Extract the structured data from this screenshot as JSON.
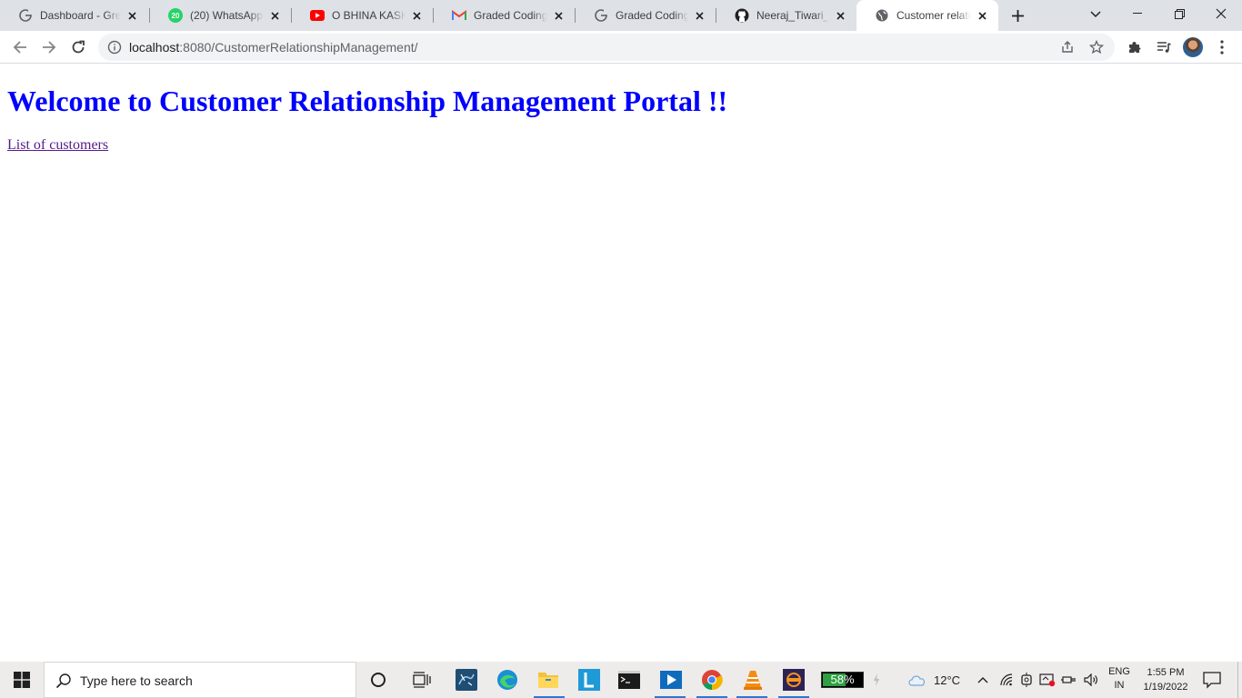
{
  "browser": {
    "tabs": [
      {
        "title": "Dashboard - Great Learning",
        "favicon": "google-icon"
      },
      {
        "title": "(20) WhatsApp",
        "favicon": "whatsapp-icon",
        "badge": "20"
      },
      {
        "title": "O BHINA KASKE",
        "favicon": "youtube-icon"
      },
      {
        "title": "Graded Coding Assignment",
        "favicon": "gmail-icon"
      },
      {
        "title": "Graded Coding Assignment",
        "favicon": "google-icon"
      },
      {
        "title": "Neeraj_Tiwari_OP",
        "favicon": "github-icon"
      },
      {
        "title": "Customer relationship",
        "favicon": "globe-icon",
        "active": true
      }
    ],
    "url_host": "localhost",
    "url_rest": ":8080/CustomerRelationshipManagement/"
  },
  "page": {
    "heading": "Welcome to Customer Relationship Management Portal !!",
    "link_text": "List of customers"
  },
  "taskbar": {
    "search_placeholder": "Type here to search",
    "battery_percent": "58%",
    "battery_level": 0.58,
    "temperature": "12°C",
    "lang_line1": "ENG",
    "lang_line2": "IN",
    "time": "1:55 PM",
    "date": "1/19/2022"
  },
  "colors": {
    "heading": "#0000ff",
    "visited_link": "#551a8b",
    "tabstrip": "#dee1e6",
    "taskbar": "#eeebeb"
  }
}
